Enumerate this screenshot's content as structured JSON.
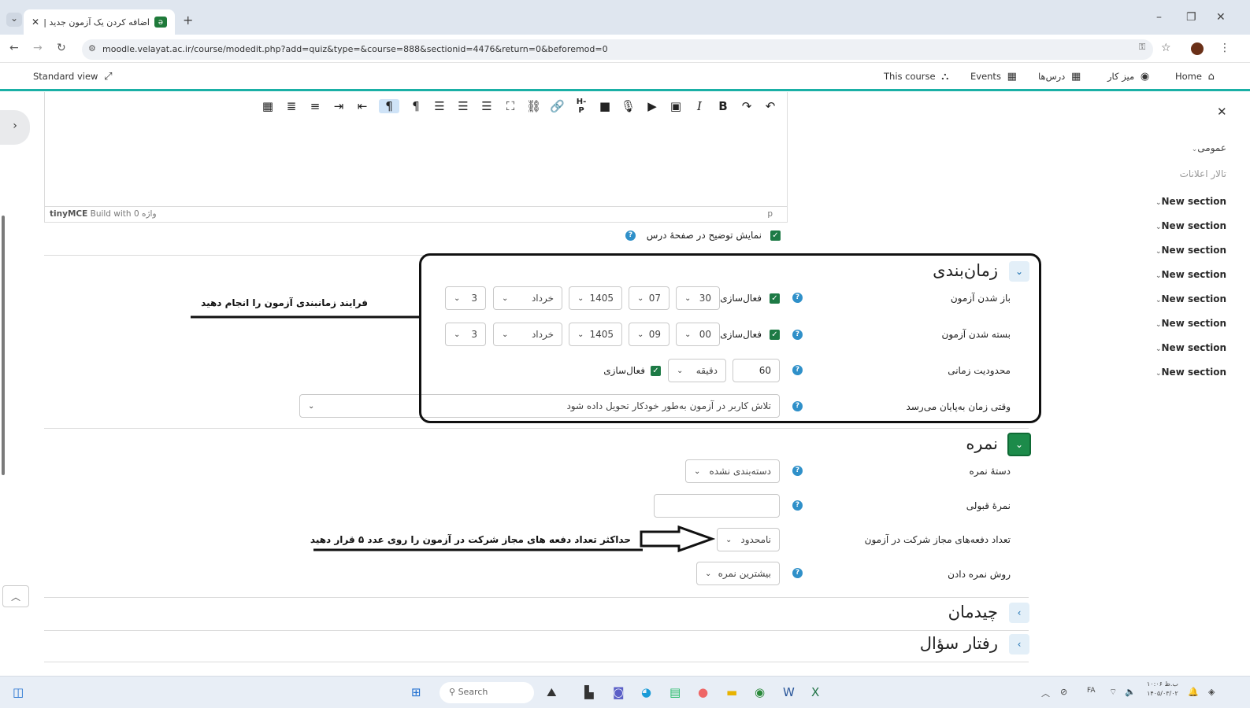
{
  "browser": {
    "tab_title": "اضافه کردن یک آزمون جدید | 888",
    "url": "moodle.velayat.ac.ir/course/modedit.php?add=quiz&type=&course=888&sectionid=4476&return=0&beforemod=0"
  },
  "moodle_nav": {
    "standard_view": "Standard view",
    "this_course": "This course",
    "events": "Events",
    "courses": "درس‌ها",
    "dashboard": "میز کار",
    "home": "Home"
  },
  "editor": {
    "brand": "tinyMCE",
    "build_with": "Build with",
    "word_count": "0 واژه",
    "path": "p"
  },
  "show_description_label": "نمایش توضیح در صفحهٔ درس",
  "timing": {
    "title": "زمان‌بندی",
    "open_label": "باز شدن آزمون",
    "close_label": "بسته شدن آزمون",
    "enable_label": "فعال‌سازی",
    "open": {
      "day": "30",
      "hour": "07",
      "year": "1405",
      "month": "خرداد",
      "minute_day": "3"
    },
    "close": {
      "day": "00",
      "hour": "09",
      "year": "1405",
      "month": "خرداد",
      "minute_day": "3"
    },
    "time_limit_label": "محدودیت زمانی",
    "time_limit_value": "60",
    "time_limit_unit": "دقیقه",
    "when_expires_label": "وقتی زمان به‌پایان می‌رسد",
    "when_expires_value": "تلاش کاربر در آزمون به‌طور خودکار تحویل داده شود"
  },
  "grade": {
    "title": "نمره",
    "category_label": "دستهٔ نمره",
    "category_value": "دسته‌بندی نشده",
    "pass_label": "نمرهٔ قبولی",
    "pass_value": "",
    "attempts_label": "تعداد دفعه‌های مجاز شرکت در آزمون",
    "attempts_value": "نامحدود",
    "method_label": "روش نمره دادن",
    "method_value": "بیشترین نمره"
  },
  "layout_section": {
    "title": "چیدمان"
  },
  "question_behaviour": {
    "title": "رفتار سؤال"
  },
  "annotations": {
    "timing_note": "فرایند زمانبندی آزمون را انجام دهید",
    "attempts_note": "حداکثر تعداد دفعه های مجاز شرکت در آزمون را روی عدد ۵ قرار دهید"
  },
  "course_index": {
    "general": "عمومی",
    "announcements": "تالار اعلانات",
    "sections": [
      "New section",
      "New section",
      "New section",
      "New section",
      "New section",
      "New section",
      "New section",
      "New section"
    ]
  },
  "taskbar": {
    "search": "Search",
    "lang": "FA",
    "clock_time": "۱۰:۰۶ ب.ظ",
    "clock_date": "۱۴۰۵/۰۳/۰۲"
  }
}
